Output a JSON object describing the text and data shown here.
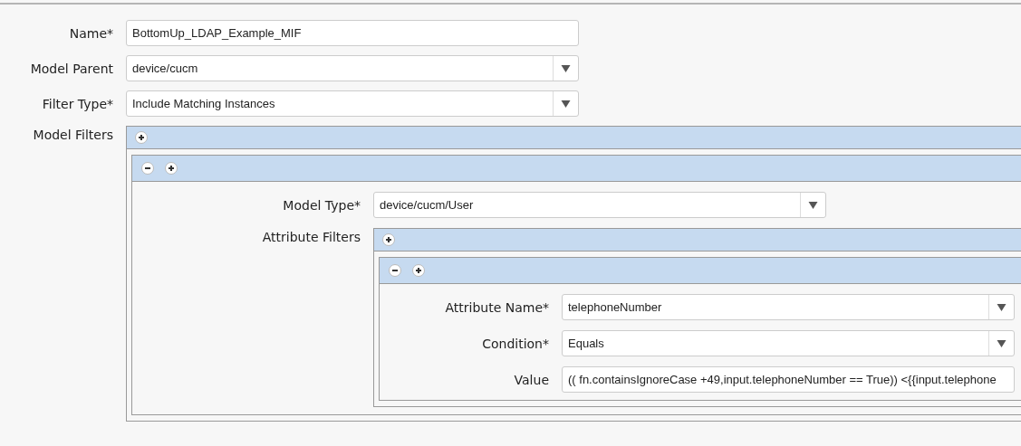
{
  "fields": [
    {
      "kind": "text",
      "label": "Name*",
      "value": "BottomUp_LDAP_Example_MIF"
    },
    {
      "kind": "select",
      "label": "Model Parent",
      "value": "device/cucm"
    },
    {
      "kind": "select",
      "label": "Filter Type*",
      "value": "Include Matching Instances"
    },
    {
      "kind": "list",
      "label": "Model Filters",
      "entries": [
        {
          "fields": [
            {
              "kind": "select",
              "label": "Model Type*",
              "value": "device/cucm/User"
            },
            {
              "kind": "list",
              "label": "Attribute Filters",
              "entries": [
                {
                  "fields": [
                    {
                      "kind": "select",
                      "label": "Attribute Name*",
                      "value": "telephoneNumber"
                    },
                    {
                      "kind": "select",
                      "label": "Condition*",
                      "value": "Equals"
                    },
                    {
                      "kind": "text",
                      "label": "Value",
                      "value": "(( fn.containsIgnoreCase +49,input.telephoneNumber == True)) <{{input.telephone"
                    }
                  ]
                }
              ]
            }
          ]
        }
      ]
    }
  ]
}
